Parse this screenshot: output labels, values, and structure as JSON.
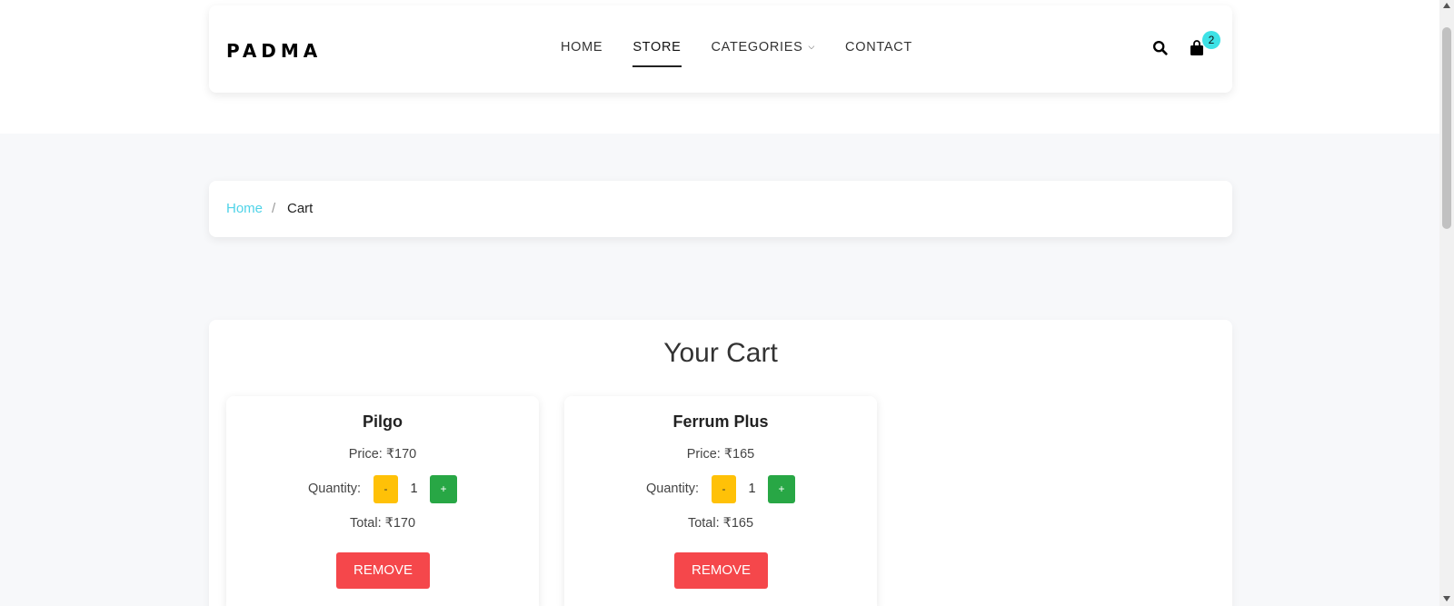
{
  "brand": {
    "logo": "PADMA"
  },
  "nav": {
    "items": [
      {
        "label": "HOME",
        "active": false
      },
      {
        "label": "STORE",
        "active": true
      },
      {
        "label": "CATEGORIES",
        "active": false,
        "dropdown": true
      },
      {
        "label": "CONTACT",
        "active": false
      }
    ],
    "icons": {
      "search": "search-icon",
      "cart": "shopping-bag-icon",
      "dropdown": "chevron-down-icon"
    },
    "cart_count": "2"
  },
  "breadcrumb": {
    "home": "Home",
    "separator": "/",
    "current": "Cart"
  },
  "cart": {
    "title": "Your Cart",
    "items": [
      {
        "name": "Pilgo",
        "price": "Price: ₹170",
        "quantity_label": "Quantity:",
        "minus": "-",
        "quantity": "1",
        "plus": "+",
        "total": "Total: ₹170",
        "remove": "REMOVE"
      },
      {
        "name": "Ferrum Plus",
        "price": "Price: ₹165",
        "quantity_label": "Quantity:",
        "minus": "-",
        "quantity": "1",
        "plus": "+",
        "total": "Total: ₹165",
        "remove": "REMOVE"
      }
    ]
  },
  "colors": {
    "accent": "#4fd3e8",
    "badge": "#3ee2e6",
    "minus_button": "#ffc107",
    "plus_button": "#28a745",
    "remove_button": "#f5474b",
    "page_background": "#f7f8fa"
  }
}
